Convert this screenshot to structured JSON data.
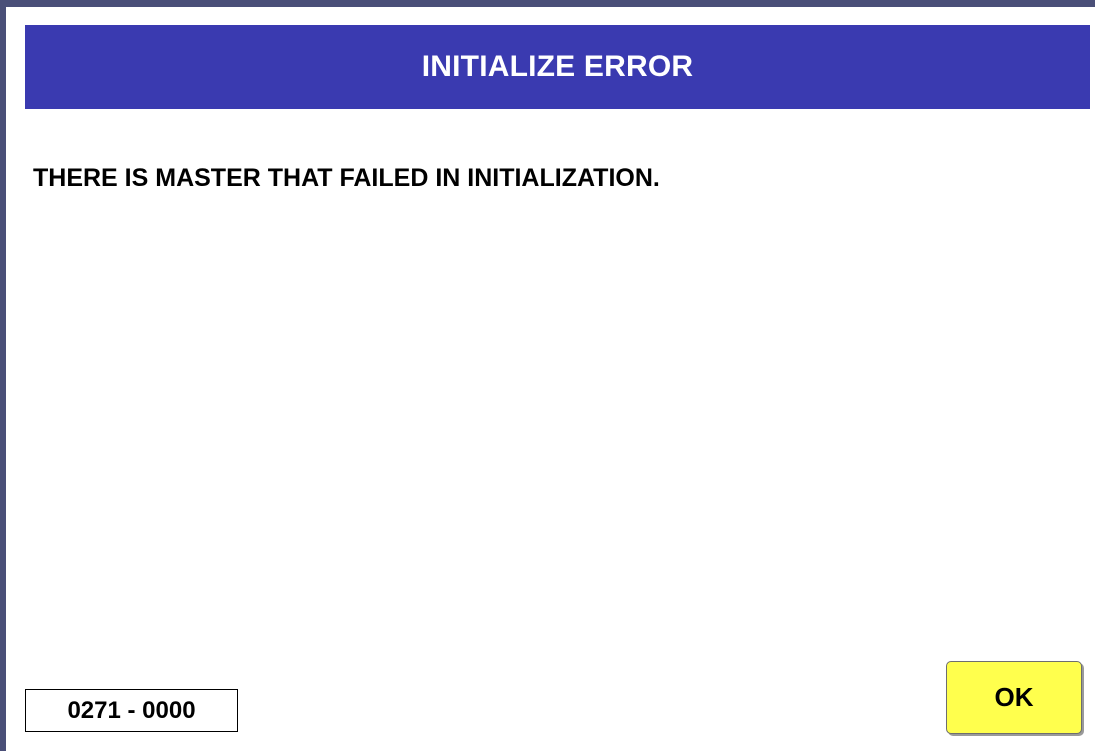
{
  "dialog": {
    "title": "INITIALIZE ERROR",
    "message": "THERE IS MASTER THAT FAILED IN INITIALIZATION.",
    "error_code": "0271 - 0000",
    "ok_label": "OK"
  },
  "colors": {
    "title_bar": "#3a3ab0",
    "frame": "#4a4f78",
    "ok_button": "#ffff4d",
    "background": "#ffffff"
  }
}
